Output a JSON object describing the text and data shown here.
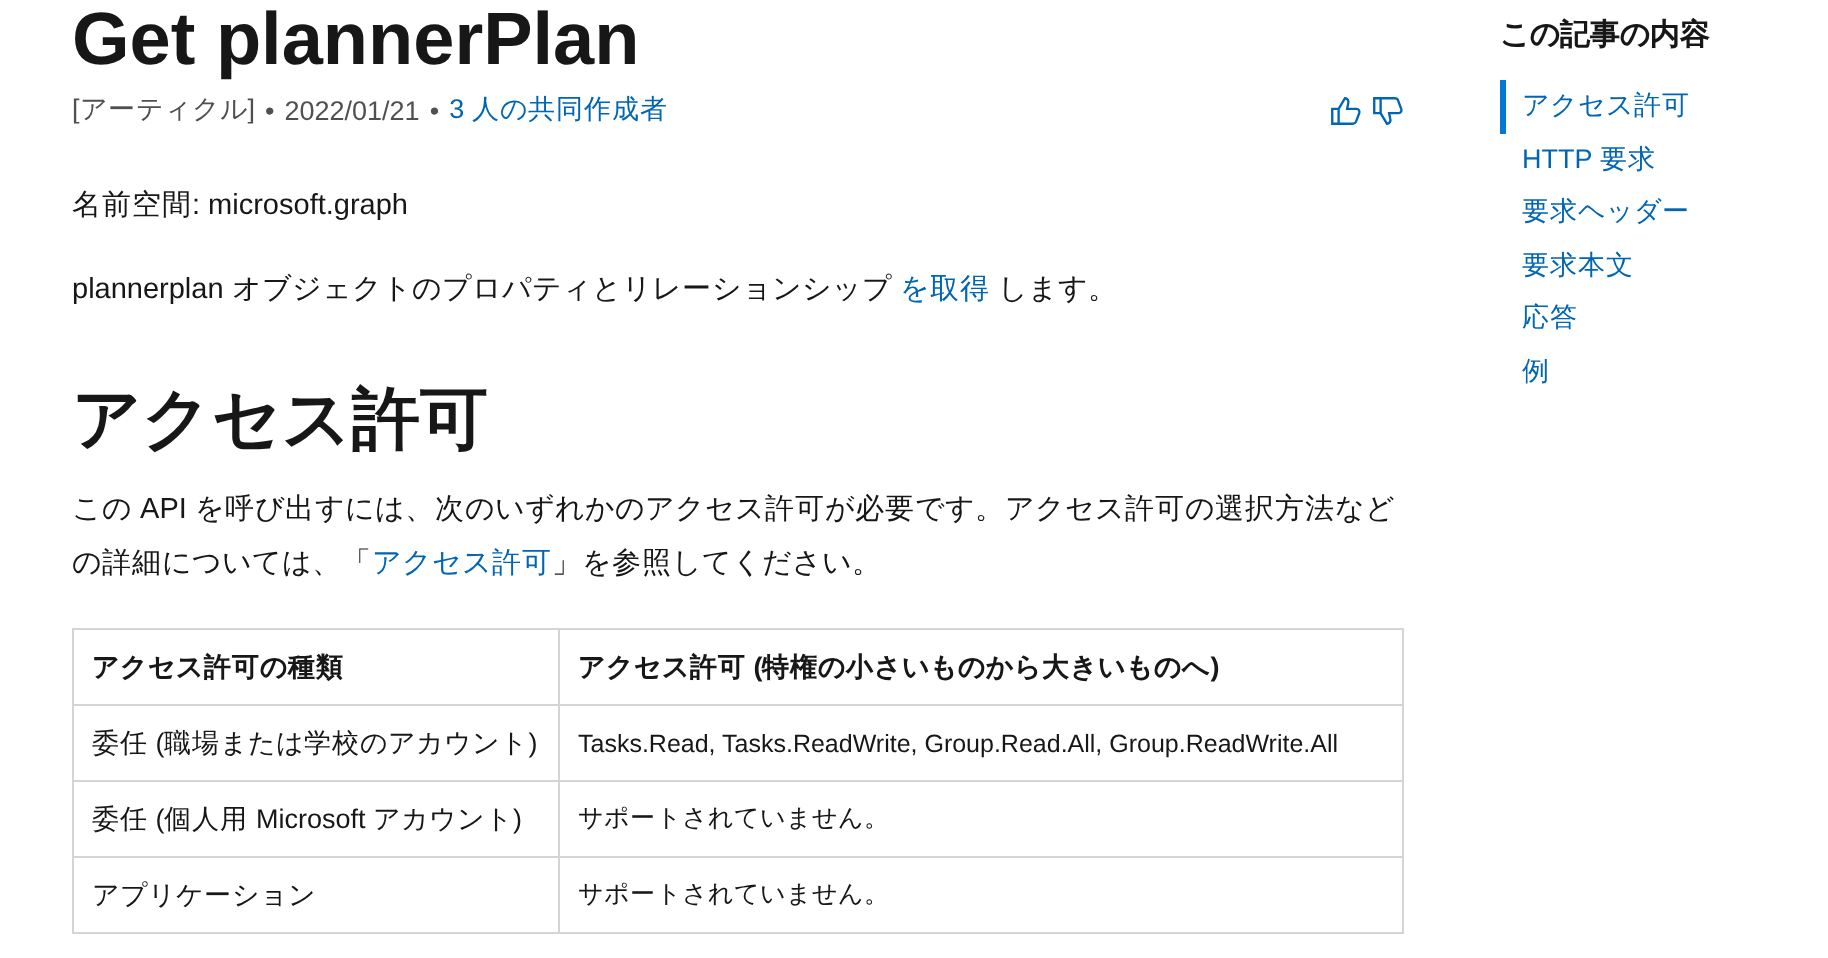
{
  "article": {
    "title": "Get plannerPlan",
    "meta": {
      "type": "[アーティクル]",
      "separators": [
        "•",
        "•"
      ],
      "date": "2022/01/21",
      "contributors": "3 人の共同作成者"
    },
    "namespace": "名前空間: microsoft.graph",
    "description": {
      "before": "plannerplan オブジェクトのプロパティとリレーションシップ ",
      "link": "を取得",
      "after": " します。"
    },
    "section": {
      "heading": "アクセス許可",
      "text": {
        "before": "この API を呼び出すには、次のいずれかのアクセス許可が必要です。アクセス許可の選択方法などの詳細については、「",
        "link": "アクセス許可",
        "after": "」を参照してください。"
      },
      "table": {
        "columns": [
          "アクセス許可の種類",
          "アクセス許可 (特権の小さいものから大きいものへ)"
        ],
        "rows": [
          [
            "委任 (職場または学校のアカウント)",
            "Tasks.Read, Tasks.ReadWrite, Group.Read.All, Group.ReadWrite.All"
          ],
          [
            "委任 (個人用 Microsoft アカウント)",
            "サポートされていません。"
          ],
          [
            "アプリケーション",
            "サポートされていません。"
          ]
        ]
      }
    }
  },
  "toc": {
    "title": "この記事の内容",
    "items": [
      {
        "label": "アクセス許可",
        "selected": true
      },
      {
        "label": "HTTP 要求",
        "selected": false
      },
      {
        "label": "要求ヘッダー",
        "selected": false
      },
      {
        "label": "要求本文",
        "selected": false
      },
      {
        "label": "応答",
        "selected": false
      },
      {
        "label": "例",
        "selected": false
      }
    ]
  }
}
